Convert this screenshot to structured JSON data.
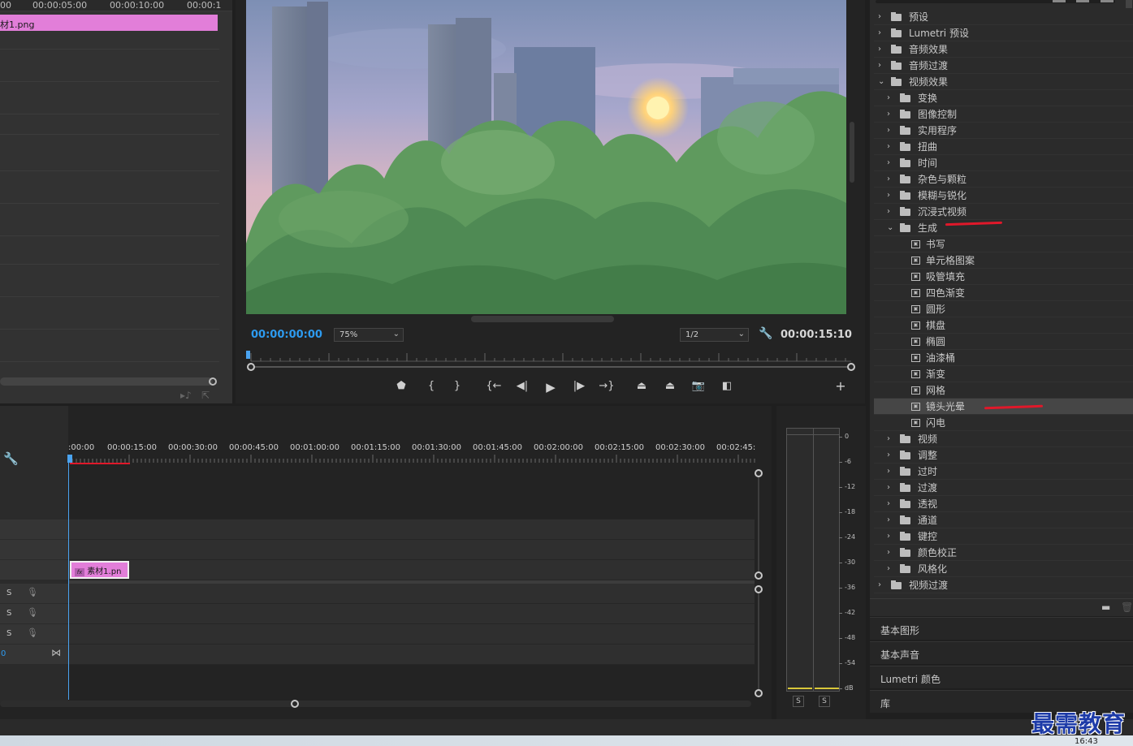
{
  "source_panel": {
    "ruler_labels": [
      "00",
      "00:00:05:00",
      "00:00:10:00",
      "00:00:1"
    ],
    "clip_label": "材1.png"
  },
  "program_monitor": {
    "timecode_current": "00:00:00:00",
    "zoom": "75%",
    "resolution": "1/2",
    "timecode_duration": "00:00:15:10",
    "transport_icons": [
      "marker-icon",
      "mark-in-icon",
      "mark-out-icon",
      "go-to-in-icon",
      "step-back-icon",
      "play-icon",
      "step-forward-icon",
      "go-to-out-icon",
      "lift-icon",
      "extract-icon",
      "export-frame-icon",
      "compare-icon",
      "add-button-icon"
    ]
  },
  "effects_panel": {
    "items": [
      {
        "label": "预设",
        "level": 0,
        "type": "folder-special",
        "expanded": false
      },
      {
        "label": "Lumetri 预设",
        "level": 0,
        "type": "folder-special",
        "expanded": false
      },
      {
        "label": "音频效果",
        "level": 0,
        "type": "folder",
        "expanded": false
      },
      {
        "label": "音频过渡",
        "level": 0,
        "type": "folder",
        "expanded": false
      },
      {
        "label": "视频效果",
        "level": 0,
        "type": "folder",
        "expanded": true
      },
      {
        "label": "变换",
        "level": 1,
        "type": "folder",
        "expanded": false
      },
      {
        "label": "图像控制",
        "level": 1,
        "type": "folder",
        "expanded": false
      },
      {
        "label": "实用程序",
        "level": 1,
        "type": "folder",
        "expanded": false
      },
      {
        "label": "扭曲",
        "level": 1,
        "type": "folder",
        "expanded": false
      },
      {
        "label": "时间",
        "level": 1,
        "type": "folder",
        "expanded": false
      },
      {
        "label": "杂色与颗粒",
        "level": 1,
        "type": "folder",
        "expanded": false
      },
      {
        "label": "模糊与锐化",
        "level": 1,
        "type": "folder",
        "expanded": false
      },
      {
        "label": "沉浸式视频",
        "level": 1,
        "type": "folder",
        "expanded": false
      },
      {
        "label": "生成",
        "level": 1,
        "type": "folder",
        "expanded": true
      },
      {
        "label": "书写",
        "level": 2,
        "type": "effect"
      },
      {
        "label": "单元格图案",
        "level": 2,
        "type": "effect"
      },
      {
        "label": "吸管填充",
        "level": 2,
        "type": "effect"
      },
      {
        "label": "四色渐变",
        "level": 2,
        "type": "effect"
      },
      {
        "label": "圆形",
        "level": 2,
        "type": "effect"
      },
      {
        "label": "棋盘",
        "level": 2,
        "type": "effect"
      },
      {
        "label": "椭圆",
        "level": 2,
        "type": "effect"
      },
      {
        "label": "油漆桶",
        "level": 2,
        "type": "effect"
      },
      {
        "label": "渐变",
        "level": 2,
        "type": "effect"
      },
      {
        "label": "网格",
        "level": 2,
        "type": "effect"
      },
      {
        "label": "镜头光晕",
        "level": 2,
        "type": "effect",
        "selected": true
      },
      {
        "label": "闪电",
        "level": 2,
        "type": "effect"
      },
      {
        "label": "视频",
        "level": 1,
        "type": "folder",
        "expanded": false
      },
      {
        "label": "调整",
        "level": 1,
        "type": "folder",
        "expanded": false
      },
      {
        "label": "过时",
        "level": 1,
        "type": "folder",
        "expanded": false
      },
      {
        "label": "过渡",
        "level": 1,
        "type": "folder",
        "expanded": false
      },
      {
        "label": "透视",
        "level": 1,
        "type": "folder",
        "expanded": false
      },
      {
        "label": "通道",
        "level": 1,
        "type": "folder",
        "expanded": false
      },
      {
        "label": "键控",
        "level": 1,
        "type": "folder",
        "expanded": false
      },
      {
        "label": "颜色校正",
        "level": 1,
        "type": "folder",
        "expanded": false
      },
      {
        "label": "风格化",
        "level": 1,
        "type": "folder",
        "expanded": false
      },
      {
        "label": "视频过渡",
        "level": 0,
        "type": "folder",
        "expanded": false
      }
    ],
    "sections": [
      "基本图形",
      "基本声音",
      "Lumetri 颜色",
      "库"
    ]
  },
  "timeline": {
    "ruler_labels": [
      ":00:00",
      "00:00:15:00",
      "00:00:30:00",
      "00:00:45:00",
      "00:01:00:00",
      "00:01:15:00",
      "00:01:30:00",
      "00:01:45:00",
      "00:02:00:00",
      "00:02:15:00",
      "00:02:30:00",
      "00:02:45:"
    ],
    "clip_label": "素材1.pn",
    "clip_fx": "fx",
    "audio_solo": [
      "S",
      "S",
      "S"
    ],
    "track_zero": "0"
  },
  "audio_meter": {
    "db_labels": [
      "0",
      "-6",
      "-12",
      "-18",
      "-24",
      "-30",
      "-36",
      "-42",
      "-48",
      "-54",
      "dB"
    ],
    "solo_buttons": [
      "S",
      "S"
    ]
  },
  "taskbar": {
    "clock": "16:43"
  },
  "watermark": "最需教育",
  "colors": {
    "accent_blue": "#2d9bf0",
    "clip_pink": "#e27ed9",
    "annotation_red": "#e0182a"
  }
}
